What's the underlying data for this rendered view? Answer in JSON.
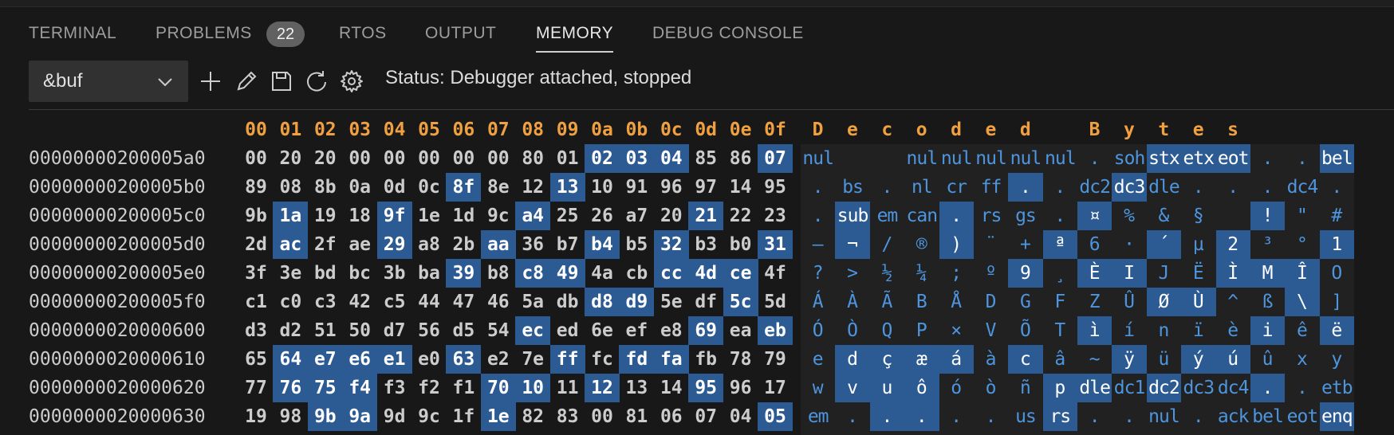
{
  "tabs": [
    {
      "label": "TERMINAL",
      "active": false
    },
    {
      "label": "PROBLEMS",
      "active": false,
      "badge": "22"
    },
    {
      "label": "RTOS",
      "active": false
    },
    {
      "label": "OUTPUT",
      "active": false
    },
    {
      "label": "MEMORY",
      "active": true
    },
    {
      "label": "DEBUG CONSOLE",
      "active": false
    }
  ],
  "toolbar": {
    "expression": "&buf",
    "icons": [
      "add-icon",
      "edit-icon",
      "save-icon",
      "refresh-icon",
      "gear-icon"
    ],
    "status": "Status: Debugger attached, stopped"
  },
  "hex_header": [
    "00",
    "01",
    "02",
    "03",
    "04",
    "05",
    "06",
    "07",
    "08",
    "09",
    "0a",
    "0b",
    "0c",
    "0d",
    "0e",
    "0f"
  ],
  "decoded_header": "Decoded Bytes",
  "colors": {
    "accent": "#f0a040",
    "highlight": "#2c5b94",
    "decoded_text": "#4d95de"
  },
  "rows": [
    {
      "addr": "00000000200005a0",
      "bytes": [
        "00",
        "20",
        "20",
        "00",
        "00",
        "00",
        "00",
        "00",
        "80",
        "01",
        "02",
        "03",
        "04",
        "85",
        "86",
        "07"
      ],
      "hex_hl": [
        10,
        11,
        12,
        15
      ],
      "decoded": [
        "nul",
        " ",
        " ",
        "nul",
        "nul",
        "nul",
        "nul",
        "nul",
        ".",
        "soh",
        "stx",
        "etx",
        "eot",
        ".",
        ".",
        "bel"
      ],
      "dec_hl": [
        10,
        11,
        12,
        15
      ]
    },
    {
      "addr": "00000000200005b0",
      "bytes": [
        "89",
        "08",
        "8b",
        "0a",
        "0d",
        "0c",
        "8f",
        "8e",
        "12",
        "13",
        "10",
        "91",
        "96",
        "97",
        "14",
        "95"
      ],
      "hex_hl": [
        6,
        9
      ],
      "decoded": [
        ".",
        "bs",
        ".",
        "nl",
        "cr",
        "ff",
        ".",
        ".",
        "dc2",
        "dc3",
        "dle",
        ".",
        ".",
        ".",
        "dc4",
        "."
      ],
      "dec_hl": [
        6,
        9
      ]
    },
    {
      "addr": "00000000200005c0",
      "bytes": [
        "9b",
        "1a",
        "19",
        "18",
        "9f",
        "1e",
        "1d",
        "9c",
        "a4",
        "25",
        "26",
        "a7",
        "20",
        "21",
        "22",
        "23"
      ],
      "hex_hl": [
        1,
        4,
        8,
        13
      ],
      "decoded": [
        ".",
        "sub",
        "em",
        "can",
        ".",
        "rs",
        "gs",
        ".",
        "¤",
        "%",
        "&",
        "§",
        " ",
        "!",
        "\"",
        "#"
      ],
      "dec_hl": [
        1,
        4,
        8,
        13
      ]
    },
    {
      "addr": "00000000200005d0",
      "bytes": [
        "2d",
        "ac",
        "2f",
        "ae",
        "29",
        "a8",
        "2b",
        "aa",
        "36",
        "b7",
        "b4",
        "b5",
        "32",
        "b3",
        "b0",
        "31"
      ],
      "hex_hl": [
        1,
        4,
        7,
        10,
        12,
        15
      ],
      "decoded": [
        "–",
        "¬",
        "/",
        "®",
        ")",
        "¨",
        "+",
        "ª",
        "6",
        "·",
        "´",
        "µ",
        "2",
        "³",
        "°",
        "1"
      ],
      "dec_hl": [
        1,
        4,
        7,
        10,
        12,
        15
      ]
    },
    {
      "addr": "00000000200005e0",
      "bytes": [
        "3f",
        "3e",
        "bd",
        "bc",
        "3b",
        "ba",
        "39",
        "b8",
        "c8",
        "49",
        "4a",
        "cb",
        "cc",
        "4d",
        "ce",
        "4f"
      ],
      "hex_hl": [
        6,
        8,
        9,
        12,
        13,
        14
      ],
      "decoded": [
        "?",
        ">",
        "½",
        "¼",
        ";",
        "º",
        "9",
        "¸",
        "È",
        "I",
        "J",
        "Ë",
        "Ì",
        "M",
        "Î",
        "O"
      ],
      "dec_hl": [
        6,
        8,
        9,
        12,
        13,
        14
      ]
    },
    {
      "addr": "00000000200005f0",
      "bytes": [
        "c1",
        "c0",
        "c3",
        "42",
        "c5",
        "44",
        "47",
        "46",
        "5a",
        "db",
        "d8",
        "d9",
        "5e",
        "df",
        "5c",
        "5d"
      ],
      "hex_hl": [
        10,
        11,
        14
      ],
      "decoded": [
        "Á",
        "À",
        "Ã",
        "B",
        "Å",
        "D",
        "G",
        "F",
        "Z",
        "Û",
        "Ø",
        "Ù",
        "^",
        "ß",
        "\\",
        "]"
      ],
      "dec_hl": [
        10,
        11,
        14
      ]
    },
    {
      "addr": "0000000020000600",
      "bytes": [
        "d3",
        "d2",
        "51",
        "50",
        "d7",
        "56",
        "d5",
        "54",
        "ec",
        "ed",
        "6e",
        "ef",
        "e8",
        "69",
        "ea",
        "eb"
      ],
      "hex_hl": [
        8,
        13,
        15
      ],
      "decoded": [
        "Ó",
        "Ò",
        "Q",
        "P",
        "×",
        "V",
        "Õ",
        "T",
        "ì",
        "í",
        "n",
        "ï",
        "è",
        "i",
        "ê",
        "ë"
      ],
      "dec_hl": [
        8,
        13,
        15
      ]
    },
    {
      "addr": "0000000020000610",
      "bytes": [
        "65",
        "64",
        "e7",
        "e6",
        "e1",
        "e0",
        "63",
        "e2",
        "7e",
        "ff",
        "fc",
        "fd",
        "fa",
        "fb",
        "78",
        "79"
      ],
      "hex_hl": [
        1,
        2,
        3,
        4,
        6,
        9,
        11,
        12
      ],
      "decoded": [
        "e",
        "d",
        "ç",
        "æ",
        "á",
        "à",
        "c",
        "â",
        "~",
        "ÿ",
        "ü",
        "ý",
        "ú",
        "û",
        "x",
        "y"
      ],
      "dec_hl": [
        1,
        2,
        3,
        4,
        6,
        9,
        11,
        12
      ]
    },
    {
      "addr": "0000000020000620",
      "bytes": [
        "77",
        "76",
        "75",
        "f4",
        "f3",
        "f2",
        "f1",
        "70",
        "10",
        "11",
        "12",
        "13",
        "14",
        "95",
        "96",
        "17"
      ],
      "hex_hl": [
        1,
        2,
        3,
        7,
        8,
        10,
        13
      ],
      "decoded": [
        "w",
        "v",
        "u",
        "ô",
        "ó",
        "ò",
        "ñ",
        "p",
        "dle",
        "dc1",
        "dc2",
        "dc3",
        "dc4",
        ".",
        ".",
        "etb"
      ],
      "dec_hl": [
        1,
        2,
        3,
        7,
        8,
        10,
        13
      ]
    },
    {
      "addr": "0000000020000630",
      "bytes": [
        "19",
        "98",
        "9b",
        "9a",
        "9d",
        "9c",
        "1f",
        "1e",
        "82",
        "83",
        "00",
        "81",
        "06",
        "07",
        "04",
        "05"
      ],
      "hex_hl": [
        2,
        3,
        7,
        15
      ],
      "decoded": [
        "em",
        ".",
        ".",
        ".",
        ".",
        ".",
        "us",
        "rs",
        ".",
        ".",
        "nul",
        ".",
        "ack",
        "bel",
        "eot",
        "enq"
      ],
      "dec_hl": [
        2,
        3,
        7,
        15
      ]
    }
  ]
}
